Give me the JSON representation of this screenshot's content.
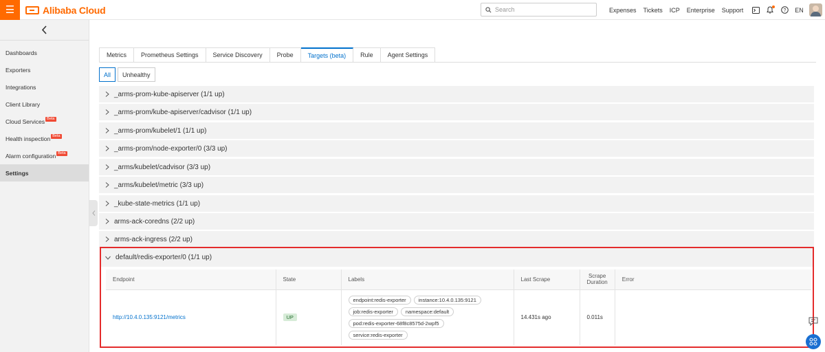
{
  "header": {
    "logo_text": "Alibaba Cloud",
    "search_placeholder": "Search",
    "nav": [
      "Expenses",
      "Tickets",
      "ICP",
      "Enterprise",
      "Support"
    ],
    "lang": "EN"
  },
  "sidebar": {
    "items": [
      {
        "label": "Dashboards"
      },
      {
        "label": "Exporters"
      },
      {
        "label": "Integrations"
      },
      {
        "label": "Client Library"
      },
      {
        "label": "Cloud Services",
        "badge": "Beta"
      },
      {
        "label": "Health inspection",
        "badge": "Beta"
      },
      {
        "label": "Alarm configuration",
        "badge": "Beta"
      },
      {
        "label": "Settings",
        "active": true
      }
    ]
  },
  "tabs": [
    "Metrics",
    "Prometheus Settings",
    "Service Discovery",
    "Probe",
    "Targets (beta)",
    "Rule",
    "Agent Settings"
  ],
  "active_tab": "Targets (beta)",
  "filters": [
    "All",
    "Unhealthy"
  ],
  "groups": [
    "_arms-prom-kube-apiserver (1/1 up)",
    "_arms-prom/kube-apiserver/cadvisor (1/1 up)",
    "_arms-prom/kubelet/1 (1/1 up)",
    "_arms-prom/node-exporter/0 (3/3 up)",
    "_arms/kubelet/cadvisor (3/3 up)",
    "_arms/kubelet/metric (3/3 up)",
    "_kube-state-metrics (1/1 up)",
    "arms-ack-coredns (2/2 up)",
    "arms-ack-ingress (2/2 up)"
  ],
  "expanded_group": {
    "title": "default/redis-exporter/0 (1/1 up)",
    "columns": {
      "endpoint": "Endpoint",
      "state": "State",
      "labels": "Labels",
      "last_scrape": "Last Scrape",
      "scrape_duration_1": "Scrape",
      "scrape_duration_2": "Duration",
      "error": "Error"
    },
    "row": {
      "endpoint": "http://10.4.0.135:9121/metrics",
      "state": "UP",
      "labels": [
        "endpoint:redis-exporter",
        "instance:10.4.0.135:9121",
        "job:redis-exporter",
        "namespace:default",
        "pod:redis-exporter-68f8c8575d-2wpf5",
        "service:redis-exporter"
      ],
      "last_scrape": "14.431s ago",
      "scrape_duration": "0.011s",
      "error": ""
    }
  },
  "colors": {
    "brand": "#ff6a00",
    "link": "#0070cc",
    "highlight": "#e42b2b",
    "state_up_bg": "#d7ecd8"
  }
}
